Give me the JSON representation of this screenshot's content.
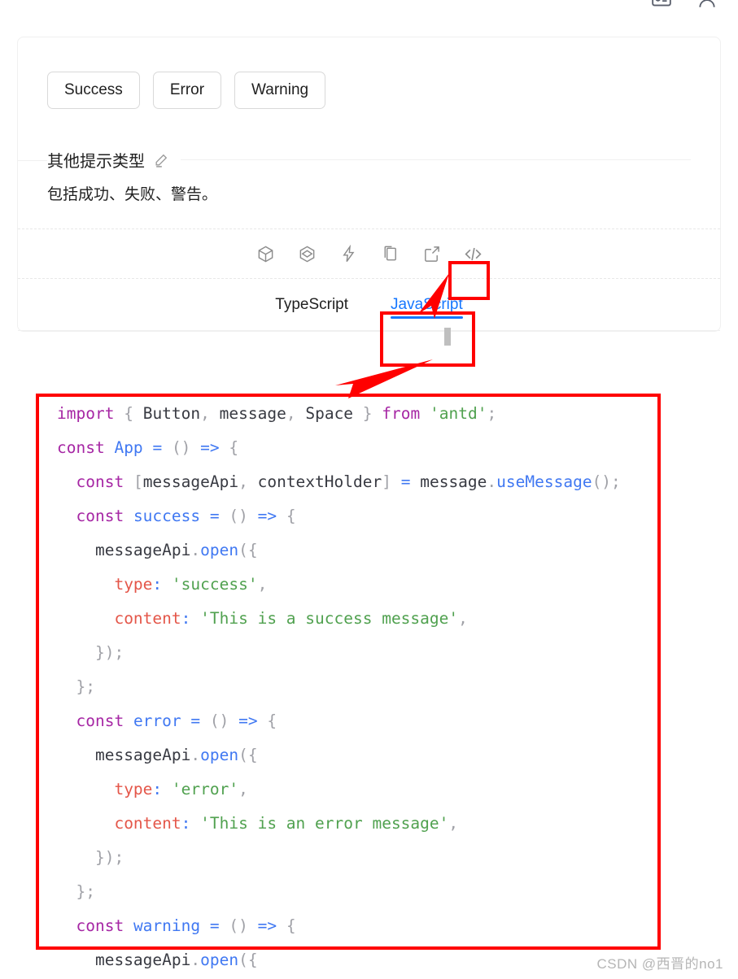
{
  "window": {
    "top_icons": [
      {
        "name": "id-card-icon"
      },
      {
        "name": "user-avatar-icon"
      }
    ]
  },
  "demo": {
    "buttons": [
      {
        "label": "Success",
        "name": "success-button"
      },
      {
        "label": "Error",
        "name": "error-button"
      },
      {
        "label": "Warning",
        "name": "warning-button"
      }
    ],
    "meta": {
      "title": "其他提示类型",
      "edit_icon": "edit-pencil-icon",
      "description": "包括成功、失败、警告。"
    },
    "toolbar": {
      "icons": [
        {
          "name": "codesandbox-icon",
          "label": "CodeSandbox"
        },
        {
          "name": "codepen-icon",
          "label": "CodePen"
        },
        {
          "name": "stackblitz-icon",
          "label": "StackBlitz"
        },
        {
          "name": "copy-icon",
          "label": "Copy"
        },
        {
          "name": "external-link-icon",
          "label": "Open in new tab"
        },
        {
          "name": "code-icon",
          "label": "Show code",
          "highlighted": true
        }
      ]
    },
    "tabs": [
      {
        "label": "TypeScript",
        "active": false
      },
      {
        "label": "JavaScript",
        "active": true
      }
    ],
    "accent_color": "#1677ff",
    "annotation_color": "#ff0000"
  },
  "code": {
    "language": "JavaScript",
    "lines": [
      "import { Button, message, Space } from 'antd';",
      "const App = () => {",
      "  const [messageApi, contextHolder] = message.useMessage();",
      "  const success = () => {",
      "    messageApi.open({",
      "      type: 'success',",
      "      content: 'This is a success message',",
      "    });",
      "  };",
      "  const error = () => {",
      "    messageApi.open({",
      "      type: 'error',",
      "      content: 'This is an error message',",
      "    });",
      "  };",
      "  const warning = () => {",
      "    messageApi.open({"
    ]
  },
  "watermark": {
    "text": "CSDN @西晋的no1"
  }
}
